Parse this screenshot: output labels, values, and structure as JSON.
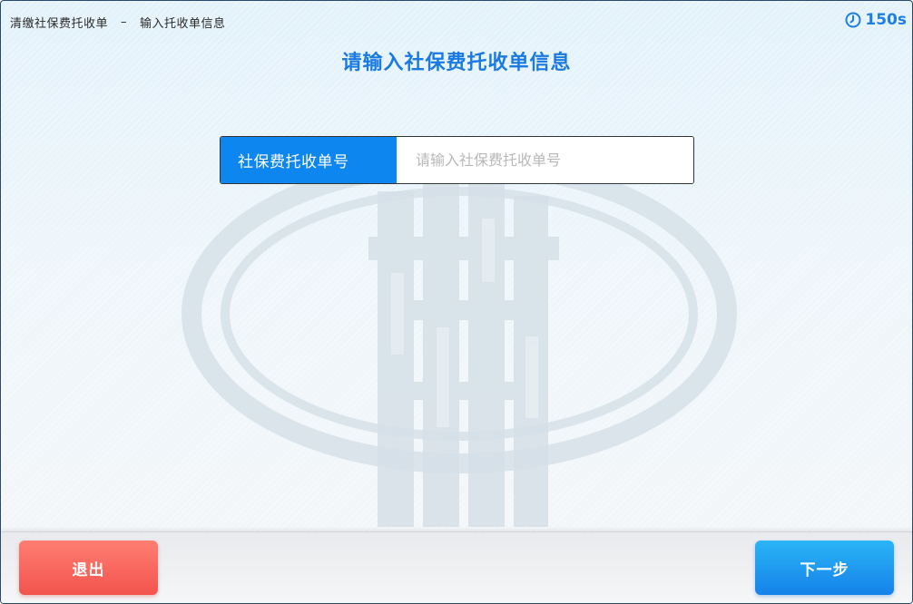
{
  "header": {
    "breadcrumb": {
      "part1": "清缴社保费托收单",
      "separator": "–",
      "part2": "输入托收单信息"
    },
    "timer": "150s"
  },
  "main": {
    "title": "请输入社保费托收单信息",
    "field": {
      "label": "社保费托收单号",
      "placeholder": "请输入社保费托收单号",
      "value": ""
    }
  },
  "footer": {
    "exit_label": "退出",
    "next_label": "下一步"
  },
  "icons": {
    "timer": "clock-icon",
    "watermark": "tax-emblem-watermark-icon"
  },
  "colors": {
    "accent": "#1a7ae0",
    "label_bg": "#0e86f0",
    "exit": "#f2544d",
    "next": "#1582ea"
  }
}
